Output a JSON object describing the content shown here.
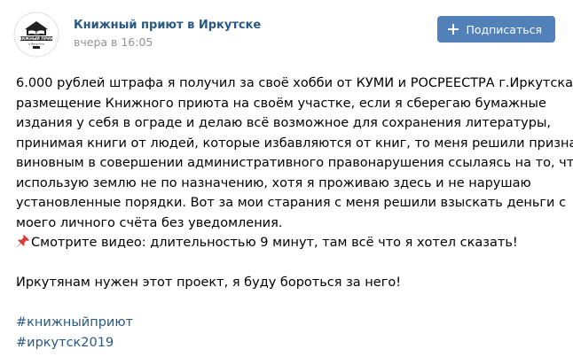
{
  "header": {
    "group_name": "Книжный приют в Иркутске",
    "timestamp": "вчера в 16:05",
    "subscribe_label": "Подписаться",
    "avatar": {
      "top_text": "КНИЖНЫЙ ПРИЮТ",
      "bottom_text": "в Иркутске"
    }
  },
  "post": {
    "lines": [
      "6.000 рублей штрафа я получил за своё хобби от КУМИ и РОСРЕЕСТРА г.Иркутска, за",
      "размещение Книжного приюта на своём участке, если я сберегаю бумажные",
      "издания у себя в ограде и делаю всё возможное для сохранения литературы,",
      "принимая книги от людей, которые избавляются от книг, то меня решили признать",
      "виновным в совершении административного правонарушения ссылаясь на то, что я",
      "использую землю не по назначению, хотя я проживаю здесь и не нарушаю",
      "установленные порядки. Вот за мои старания с меня решили взыскать деньги с",
      "моего личного счёта без уведомления."
    ],
    "video_note": "Смотрите видео: длительностью 9 минут, там всё что я хотел сказать!",
    "closing": "Иркутянам нужен этот проект, я буду бороться за него!",
    "hashtags": [
      "#книжныйприют",
      "#иркутск2019"
    ]
  },
  "colors": {
    "link": "#2a5885",
    "button": "#5181b8",
    "muted": "#939393"
  }
}
